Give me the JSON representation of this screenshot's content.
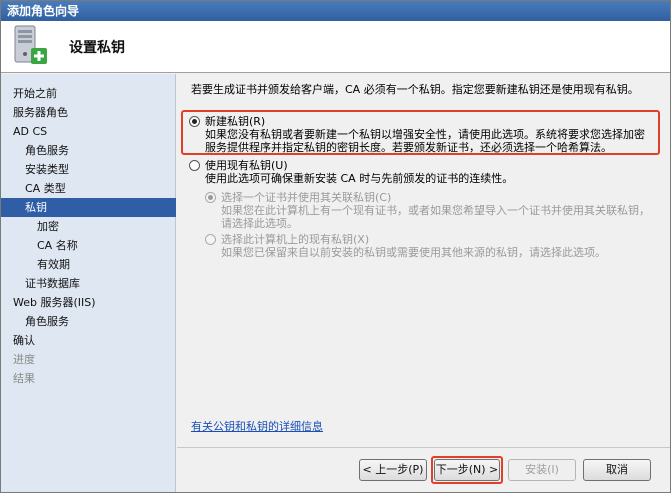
{
  "window": {
    "title": "添加角色向导"
  },
  "header": {
    "title": "设置私钥",
    "icon": "server-add-icon"
  },
  "nav": {
    "items": [
      {
        "label": "开始之前",
        "indent": 12,
        "state": "normal"
      },
      {
        "label": "服务器角色",
        "indent": 12,
        "state": "normal"
      },
      {
        "label": "AD CS",
        "indent": 12,
        "state": "normal"
      },
      {
        "label": "角色服务",
        "indent": 24,
        "state": "normal"
      },
      {
        "label": "安装类型",
        "indent": 24,
        "state": "normal"
      },
      {
        "label": "CA 类型",
        "indent": 24,
        "state": "normal"
      },
      {
        "label": "私钥",
        "indent": 24,
        "state": "current"
      },
      {
        "label": "加密",
        "indent": 36,
        "state": "normal"
      },
      {
        "label": "CA 名称",
        "indent": 36,
        "state": "normal"
      },
      {
        "label": "有效期",
        "indent": 36,
        "state": "normal"
      },
      {
        "label": "证书数据库",
        "indent": 24,
        "state": "normal"
      },
      {
        "label": "Web 服务器(IIS)",
        "indent": 12,
        "state": "normal"
      },
      {
        "label": "角色服务",
        "indent": 24,
        "state": "normal"
      },
      {
        "label": "确认",
        "indent": 12,
        "state": "normal"
      },
      {
        "label": "进度",
        "indent": 12,
        "state": "dim"
      },
      {
        "label": "结果",
        "indent": 12,
        "state": "dim"
      }
    ]
  },
  "content": {
    "intro": "若要生成证书并颁发给客户端，CA 必须有一个私钥。指定您要新建私钥还是使用现有私钥。",
    "options": {
      "new_key": {
        "label": "新建私钥(R)",
        "desc": "如果您没有私钥或者要新建一个私钥以增强安全性，请使用此选项。系统将要求您选择加密服务提供程序并指定私钥的密钥长度。若要颁发新证书，还必须选择一个哈希算法。"
      },
      "existing_key": {
        "label": "使用现有私钥(U)",
        "desc": "使用此选项可确保重新安装 CA 时与先前颁发的证书的连续性。"
      },
      "cert_key": {
        "label": "选择一个证书并使用其关联私钥(C)",
        "desc": "如果您在此计算机上有一个现有证书，或者如果您希望导入一个证书并使用其关联私钥，请选择此选项。"
      },
      "existing_on_machine": {
        "label": "选择此计算机上的现有私钥(X)",
        "desc": "如果您已保留来自以前安装的私钥或需要使用其他来源的私钥，请选择此选项。"
      }
    },
    "link": "有关公钥和私钥的详细信息"
  },
  "buttons": {
    "prev": "< 上一步(P)",
    "next": "下一步(N) >",
    "install": "安装(I)",
    "cancel": "取消"
  }
}
